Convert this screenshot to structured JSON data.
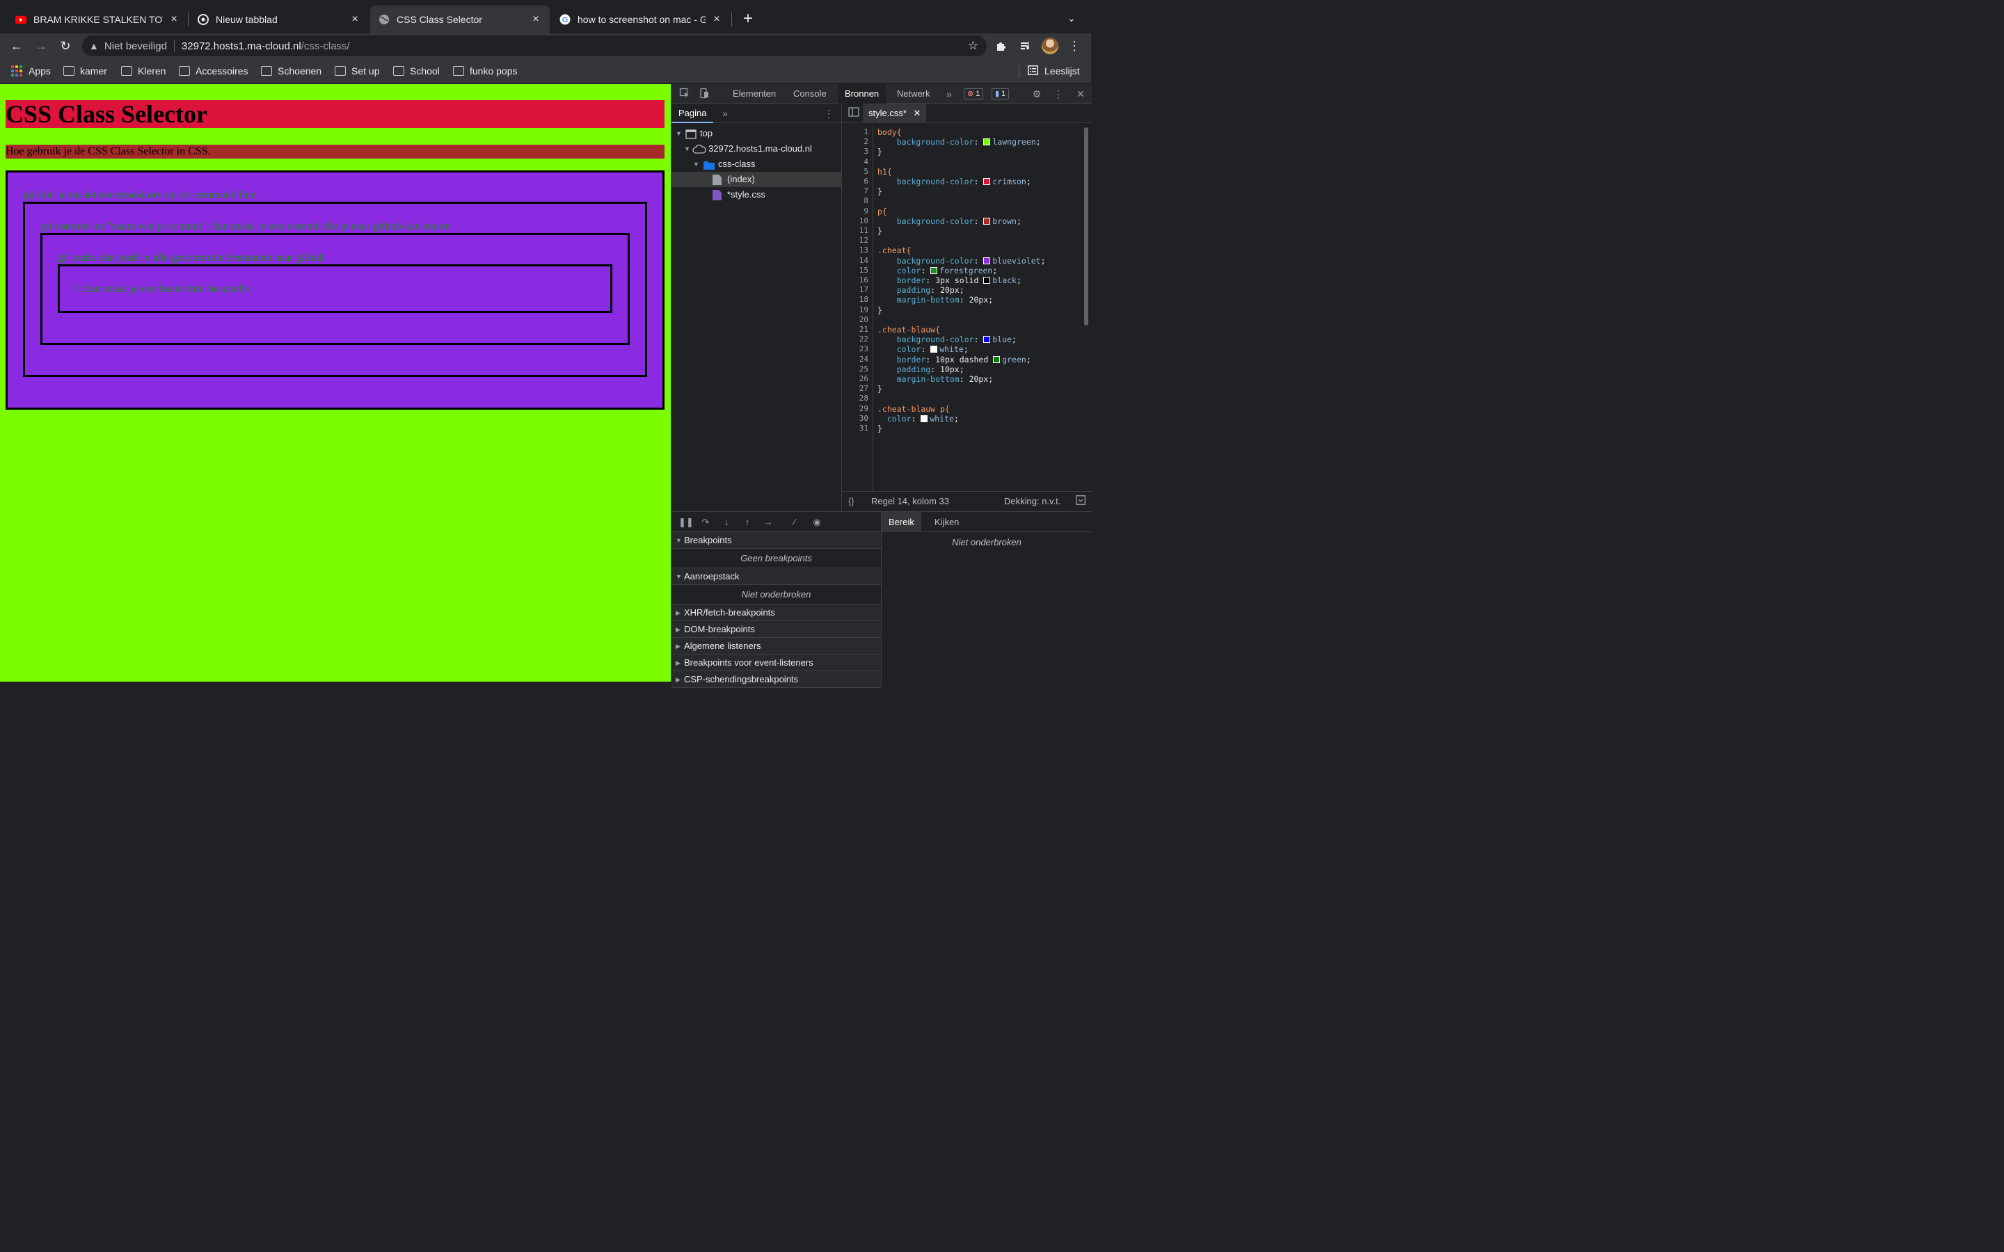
{
  "tabs": [
    {
      "title": "BRAM KRIKKE STALKEN TOT IN",
      "favicon": "youtube-icon"
    },
    {
      "title": "Nieuw tabblad",
      "favicon": "chrome-icon"
    },
    {
      "title": "CSS Class Selector",
      "favicon": "globe-icon"
    },
    {
      "title": "how to screenshot on mac - Go",
      "favicon": "google-icon"
    }
  ],
  "omnibox": {
    "security_label": "Niet beveiligd",
    "host": "32972.hosts1.ma-cloud.nl",
    "path": "/css-class/"
  },
  "bookmarks": {
    "apps": "Apps",
    "items": [
      "kamer",
      "Kleren",
      "Accessoires",
      "Schoenen",
      "Set up",
      "School",
      "funko pops"
    ],
    "reading_list": "Leeslijst"
  },
  "page": {
    "h1": "CSS Class Selector",
    "p": "Hoe gebruik je de CSS Class Selector in CSS.",
    "cheats": [
      "git init: je maakt een repository op de command line",
      "git commit -m \"naam van je commit\": dan maak je een commit die je naar github kan sturen",
      "git push: dan push je alle gecommitte bestanden naar github",
      "!: dan maak je een basis html bestandje"
    ]
  },
  "devtools": {
    "tabs": [
      "Elementen",
      "Console",
      "Bronnen",
      "Netwerk"
    ],
    "active_tab": "Bronnen",
    "error_count": "1",
    "message_count": "1",
    "navigator": {
      "tab": "Pagina",
      "tree": [
        "top",
        "32972.hosts1.ma-cloud.nl",
        "css-class",
        "(index)",
        "*style.css"
      ]
    },
    "editor": {
      "file_tab": "style.css*",
      "lines": [
        {
          "sel": "body{"
        },
        {
          "prop": "background-color",
          "val": "lawngreen",
          "swatch": "#7cfc00"
        },
        {
          "sel": "}"
        },
        {
          "sel": ""
        },
        {
          "sel": "h1{"
        },
        {
          "prop": "background-color",
          "val": "crimson",
          "swatch": "#dc143c"
        },
        {
          "sel": "}"
        },
        {
          "sel": ""
        },
        {
          "sel": "p{"
        },
        {
          "prop": "background-color",
          "val": "brown",
          "swatch": "#a52a2a"
        },
        {
          "sel": "}"
        },
        {
          "sel": ""
        },
        {
          "sel": ".cheat{"
        },
        {
          "prop": "background-color",
          "val": "blueviolet",
          "swatch": "#8a2be2"
        },
        {
          "prop": "color",
          "val": "forestgreen",
          "swatch": "#228b22"
        },
        {
          "prop": "border",
          "pre": "3px solid ",
          "val": "black",
          "swatch": "#000000"
        },
        {
          "prop": "padding",
          "pre": "20px",
          "val": ""
        },
        {
          "prop": "margin-bottom",
          "pre": "20px",
          "val": ""
        },
        {
          "sel": "}"
        },
        {
          "sel": ""
        },
        {
          "sel": ".cheat-blauw{"
        },
        {
          "prop": "background-color",
          "val": "blue",
          "swatch": "#0000ff"
        },
        {
          "prop": "color",
          "val": "white",
          "swatch": "#ffffff"
        },
        {
          "prop": "border",
          "pre": "10px dashed ",
          "val": "green",
          "swatch": "#008000"
        },
        {
          "prop": "padding",
          "pre": "10px",
          "val": ""
        },
        {
          "prop": "margin-bottom",
          "pre": "20px",
          "val": ""
        },
        {
          "sel": "}"
        },
        {
          "sel": ""
        },
        {
          "sel": ".cheat-blauw p{"
        },
        {
          "prop": "color",
          "val": "white",
          "swatch": "#ffffff",
          "indent": "short"
        },
        {
          "sel": "}"
        }
      ],
      "status_position": "Regel 14, kolom 33",
      "coverage": "Dekking: n.v.t."
    },
    "debugger": {
      "breakpoints": "Breakpoints",
      "no_breakpoints": "Geen breakpoints",
      "callstack": "Aanroepstack",
      "not_paused": "Niet onderbroken",
      "sections": [
        "XHR/fetch-breakpoints",
        "DOM-breakpoints",
        "Algemene listeners",
        "Breakpoints voor event-listeners",
        "CSP-schendingsbreakpoints"
      ],
      "scope_tabs": [
        "Bereik",
        "Kijken"
      ],
      "scope_status": "Niet onderbroken"
    }
  }
}
